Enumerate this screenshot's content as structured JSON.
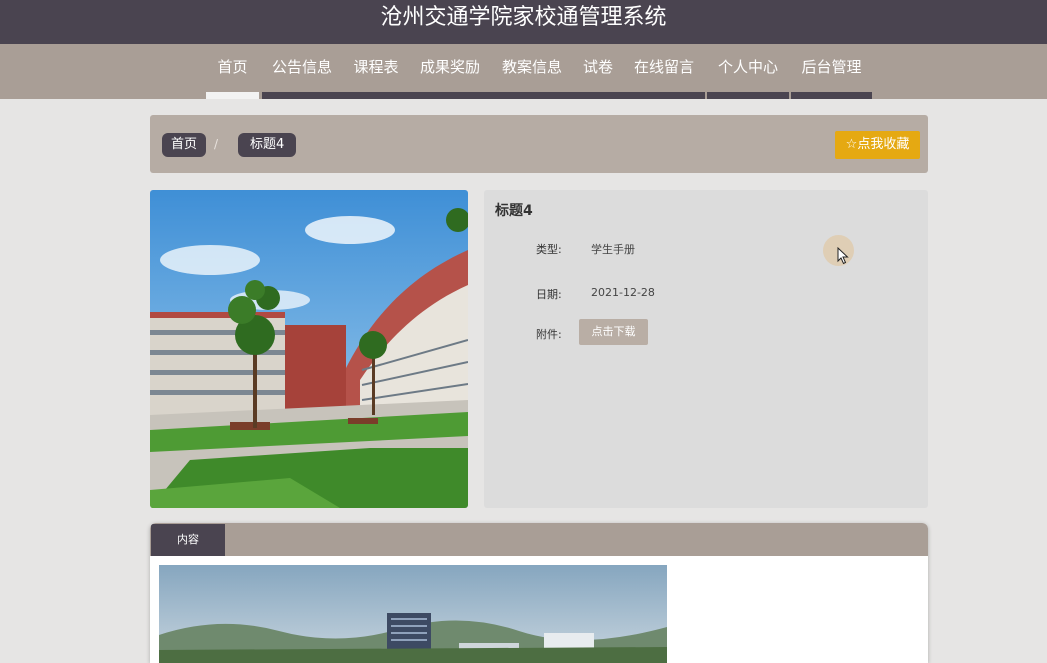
{
  "header": {
    "title": "沧州交通学院家校通管理系统"
  },
  "nav": {
    "items": [
      {
        "label": "首页",
        "active": true
      },
      {
        "label": "公告信息"
      },
      {
        "label": "课程表"
      },
      {
        "label": "成果奖励"
      },
      {
        "label": "教案信息"
      },
      {
        "label": "试卷"
      },
      {
        "label": "在线留言"
      },
      {
        "label": "个人中心"
      },
      {
        "label": "后台管理"
      }
    ]
  },
  "breadcrumb": {
    "home": "首页",
    "separator": "/",
    "current": "标题4"
  },
  "favorite_button": "☆点我收藏",
  "detail": {
    "title": "标题4",
    "type_label": "类型:",
    "type_value": "学生手册",
    "date_label": "日期:",
    "date_value": "2021-12-28",
    "attach_label": "附件:",
    "download_label": "点击下载"
  },
  "content": {
    "tab_label": "内容"
  },
  "colors": {
    "header_bg": "#4a4450",
    "nav_bg": "#a99e96",
    "accent": "#e5a912"
  }
}
